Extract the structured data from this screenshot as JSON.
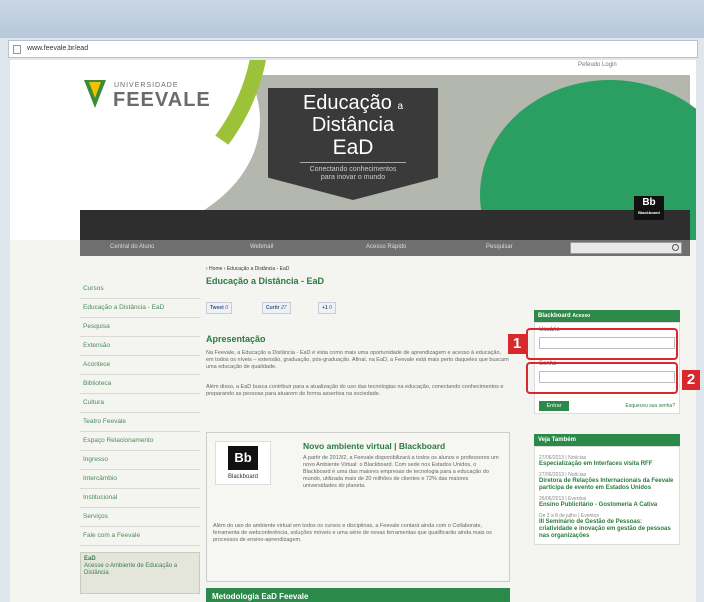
{
  "browser": {
    "url": "www.feevale.br/ead"
  },
  "header": {
    "top_link": "Pefeudo Login",
    "logo_small": "UNIVERSIDADE",
    "logo_name": "FEEVALE",
    "banner_line1": "Educação",
    "banner_a": "a",
    "banner_line2": "Distância",
    "banner_line3": "EaD",
    "banner_tag1": "Conectando conhecimentos",
    "banner_tag2": "para inovar o mundo",
    "bb_logo": "Bb",
    "bb_name": "Blackboard"
  },
  "menu": {
    "items": [
      "Central do Aluno",
      "Webmail",
      "Acesso Rápido",
      "Pesquisar"
    ]
  },
  "sidebar": {
    "items": [
      "Cursos",
      "Educação a Distância - EaD",
      "Pesquisa",
      "Extensão",
      "Acontece",
      "Biblioteca",
      "Cultura",
      "Teatro Feevale",
      "Espaço Relacionamento",
      "Ingresso",
      "Intercâmbio",
      "Institucional",
      "Serviços",
      "Fale com a Feevale"
    ],
    "ead_box": {
      "title": "EaD",
      "text": "Acesse o Ambiente de Educação a Distância"
    }
  },
  "content": {
    "breadcrumb": "› Home › Educação a Distância - EaD",
    "title": "Educação a Distância - EaD",
    "social": {
      "tweet": "Tweet",
      "tweet_count": "0",
      "like": "Curtir",
      "like_count": "27",
      "plus": "+1",
      "plus_count": "0"
    },
    "section_title": "Apresentação",
    "para1": "Na Feevale, a Educação a Distância - EaD é vista como mais uma oportunidade de aprendizagem e acesso à educação, em todos os níveis – extensão, graduação, pós-graduação. Afinal, na EaD, a Feevale está mais perto daqueles que buscam uma educação de qualidade.",
    "para2": "Além disso, a EaD busca contribuir para a atualização do uso das tecnologias na educação, conectando conhecimentos e preparando as pessoas para atuarem de forma assertiva na sociedade.",
    "bb_box": {
      "logo": "Bb",
      "logo_caption": "Blackboard",
      "title": "Novo ambiente virtual | Blackboard",
      "text1": "A partir de 2013/2, a Feevale disponibilizará a todos os alunos e professores um novo Ambiente Virtual: o Blackboard. Com sede nos Estados Unidos, o Blackboard é uma das maiores empresas de tecnologia para a educação do mundo, utilizada mais de 20 milhões de clientes e 72% das maiores universidades do planeta.",
      "text2": "Além do uso do ambiente virtual em todos os cursos e disciplinas, a Feevale contará ainda com o Collaborate, ferramenta de webconferência, soluções móveis e uma série de novas ferramentas que qualificarão ainda mais os processos de ensino-aprendizagem."
    },
    "method_title": "Metodologia EaD Feevale"
  },
  "login": {
    "header": "Blackboard",
    "header_small": "Acesso",
    "user_label": "Usuário",
    "pass_label": "Senha",
    "submit": "Entrar",
    "forgot": "Esqueceu sua senha?",
    "callout_1": "1",
    "callout_2": "2"
  },
  "veja": {
    "header": "Veja Também",
    "news": [
      {
        "date": "27/06/2013 | Notícias",
        "title": "Especialização em Interfaces visita RFF"
      },
      {
        "date": "27/06/2013 | Notícias",
        "title": "Diretora de Relações Internacionais da Feevale participa de evento em Estados Unidos"
      },
      {
        "date": "26/06/2013 | Eventos",
        "title": "Ensino Publicitário - Gostomeria A Cativa"
      },
      {
        "date": "De 3 a 8 de julho | Eventos",
        "title": "III Seminário de Gestão de Pessoas: criatividade e inovação em gestão de pessoas nas organizações"
      }
    ]
  }
}
